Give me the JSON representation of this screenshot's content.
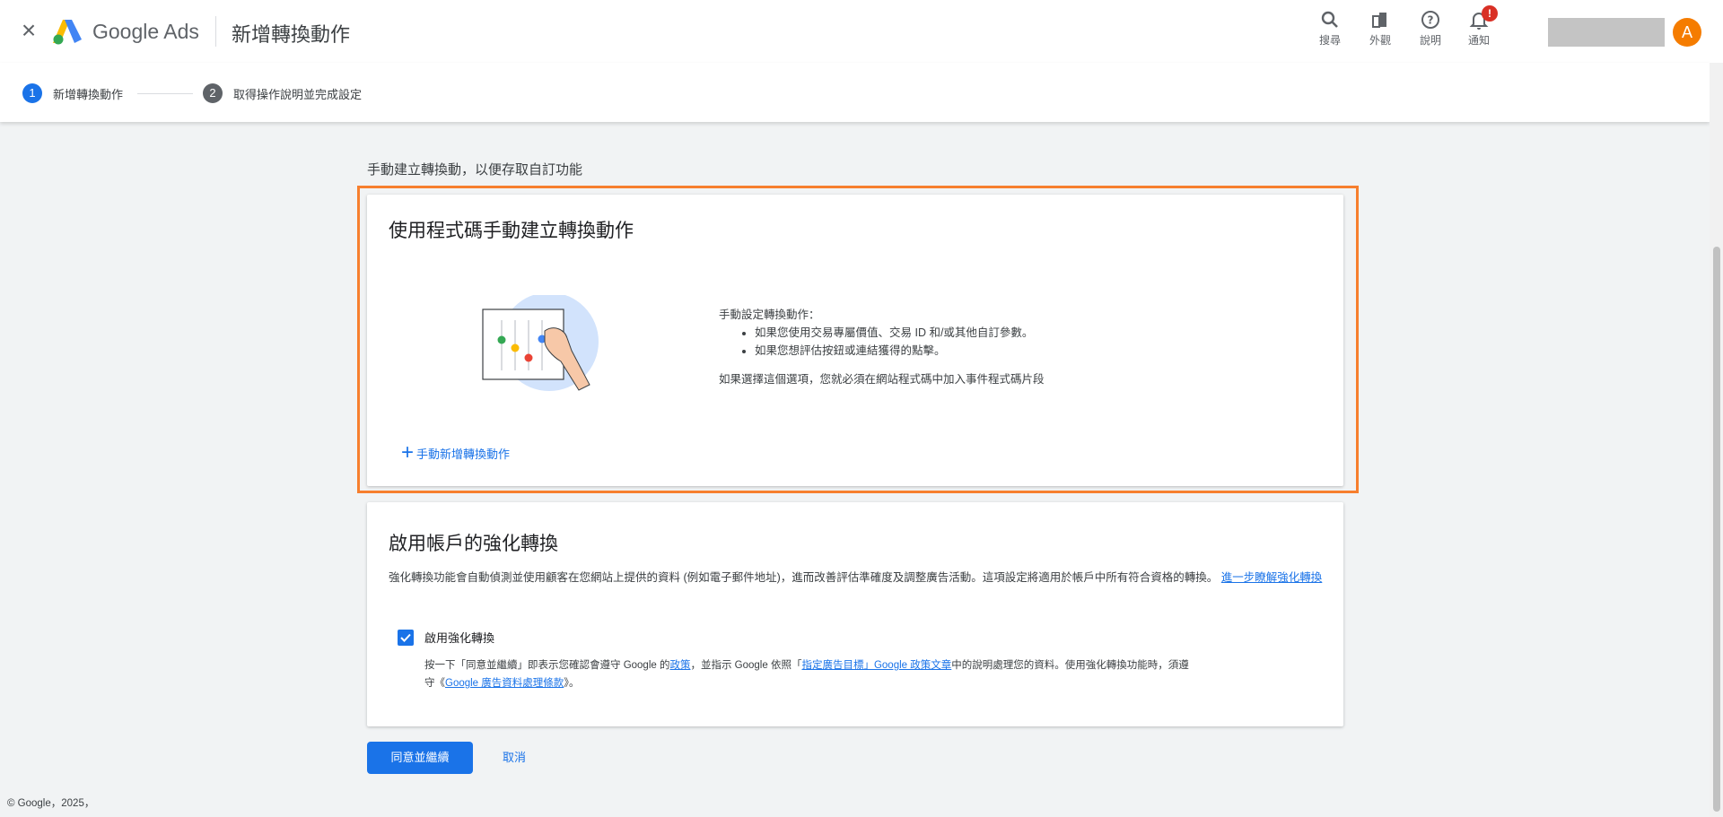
{
  "app": {
    "brand": "Google Ads",
    "title": "新增轉換動作"
  },
  "toolbar": [
    {
      "label": "搜尋",
      "icon": "search-icon"
    },
    {
      "label": "外觀",
      "icon": "appearance-icon"
    },
    {
      "label": "說明",
      "icon": "help-icon"
    },
    {
      "label": "通知",
      "icon": "bell-icon",
      "badge": "!"
    }
  ],
  "account": {
    "avatar_letter": "A",
    "avatar_color": "#f57c00"
  },
  "steps": [
    {
      "num": "1",
      "label": "新增轉換動作",
      "active": true
    },
    {
      "num": "2",
      "label": "取得操作說明並完成設定",
      "active": false
    }
  ],
  "section_label": "手動建立轉換動，以便存取自訂功能",
  "manual_card": {
    "title": "使用程式碼手動建立轉換動作",
    "intro": "手動設定轉換動作：",
    "bullets": [
      "如果您使用交易專屬價值、交易 ID 和/或其他自訂參數。",
      "如果您想評估按鈕或連結獲得的點擊。"
    ],
    "note": "如果選擇這個選項，您就必須在網站程式碼中加入事件程式碼片段",
    "add_label": "手動新增轉換動作"
  },
  "enhanced_card": {
    "title": "啟用帳戶的強化轉換",
    "body": "強化轉換功能會自動偵測並使用顧客在您網站上提供的資料 (例如電子郵件地址)，進而改善評估準確度及調整廣告活動。這項設定將適用於帳戶中所有符合資格的轉換。",
    "learn_more": "進一步瞭解強化轉換",
    "checkbox_label": "啟用強化轉換",
    "checkbox_checked": true,
    "legal": {
      "p1": "按一下「同意並繼續」即表示您確認會遵守 Google 的",
      "link1": "政策",
      "p2": "，並指示 Google 依照「",
      "link2": "指定廣告目標」Google 政策文章",
      "p3": "中的說明處理您的資料。使用強化轉換功能時，須遵守《",
      "link3": "Google 廣告資料處理條款",
      "p4": "》。"
    }
  },
  "actions": {
    "primary": "同意並繼續",
    "cancel": "取消"
  },
  "footer": "© Google，2025，",
  "colors": {
    "accent": "#1a73e8",
    "highlight": "#f77f2e",
    "badge": "#d93025"
  }
}
